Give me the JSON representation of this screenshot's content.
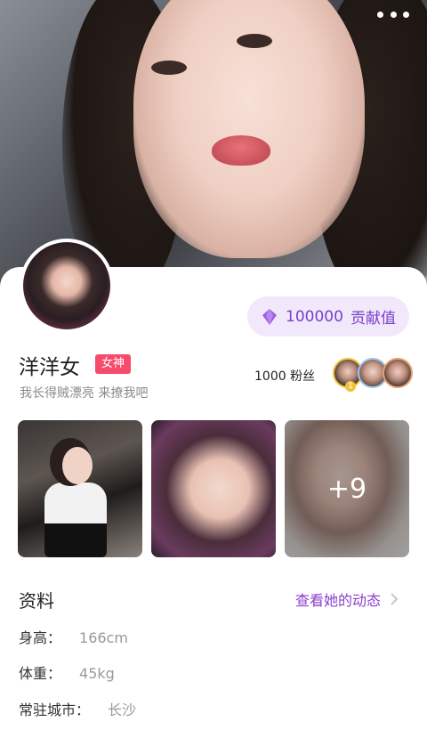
{
  "profile": {
    "name": "洋洋女",
    "tag": "女神",
    "bio": "我长得贼漂亮 来撩我吧",
    "contribution_value": "100000",
    "contribution_label": "贡献值",
    "fans_text": "1000 粉丝"
  },
  "photos": {
    "more_count_label": "+9"
  },
  "section": {
    "title": "资料",
    "link_label": "查看她的动态"
  },
  "info": [
    {
      "label": "身高：",
      "value": "166cm"
    },
    {
      "label": "体重：",
      "value": "45kg"
    },
    {
      "label": "常驻城市：",
      "value": "长沙"
    }
  ],
  "colors": {
    "accent_purple": "#8a3fce",
    "tag_red": "#f64b6a",
    "contrib_bg": "#f1e9fb"
  },
  "icons": {
    "more": "more-dots-icon",
    "gem": "diamond-icon",
    "chevron": "chevron-right-icon"
  }
}
